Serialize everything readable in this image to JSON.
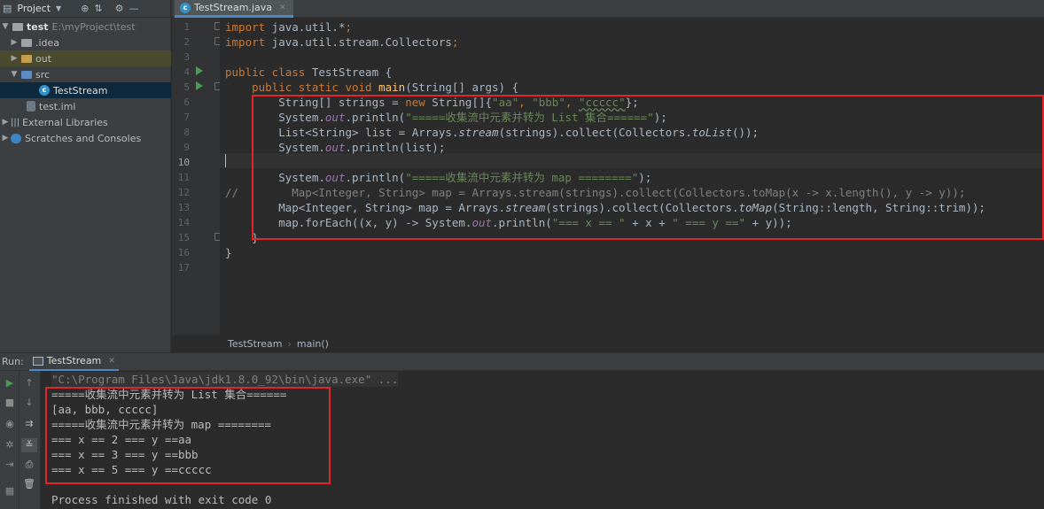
{
  "project_panel": {
    "header": {
      "title": "Project",
      "dropdown_icon": "chevron-down-icon",
      "icons": [
        "target-icon",
        "collapse-icon",
        "gear-icon",
        "minimize-icon"
      ]
    },
    "tree": [
      {
        "label": "test",
        "detail": "E:\\myProject\\test",
        "depth": 0,
        "expanded": true,
        "icon": "module-folder-icon"
      },
      {
        "label": ".idea",
        "depth": 1,
        "expanded": false,
        "icon": "folder-icon"
      },
      {
        "label": "out",
        "depth": 1,
        "expanded": false,
        "icon": "folder-icon"
      },
      {
        "label": "src",
        "depth": 1,
        "expanded": true,
        "icon": "source-folder-icon"
      },
      {
        "label": "TestStream",
        "depth": 2,
        "selected": true,
        "icon": "java-class-icon"
      },
      {
        "label": "test.iml",
        "depth": 1,
        "icon": "iml-file-icon"
      },
      {
        "label": "External Libraries",
        "depth": 0,
        "expanded": false,
        "icon": "libraries-icon"
      },
      {
        "label": "Scratches and Consoles",
        "depth": 0,
        "expanded": false,
        "icon": "scratches-icon"
      }
    ]
  },
  "editor": {
    "tab_label": "TestStream.java",
    "line_numbers": [
      "1",
      "2",
      "3",
      "4",
      "5",
      "6",
      "7",
      "8",
      "9",
      "10",
      "11",
      "12",
      "13",
      "14",
      "15",
      "16",
      "17"
    ],
    "current_line": "10",
    "code": {
      "l1_a": "import",
      "l1_b": " java.util.*",
      "l1_c": ";",
      "l2_a": "import",
      "l2_b": " java.util.stream.Collectors",
      "l2_c": ";",
      "l4_a": "public class",
      "l4_b": " TestStream {",
      "l5_a": "    public static void ",
      "l5_b": "main",
      "l5_c": "(String[] args) {",
      "l6_a": "        String[] strings = ",
      "l6_b": "new",
      "l6_c": " String[]{",
      "l6_d": "\"aa\"",
      "l6_e": ", ",
      "l6_f": "\"bbb\"",
      "l6_g": ", ",
      "l6_h": "\"ccccc\"",
      "l6_i": "};",
      "l7_a": "        System.",
      "l7_b": "out",
      "l7_c": ".println(",
      "l7_d": "\"=====收集流中元素并转为 List 集合======\"",
      "l7_e": ");",
      "l8_a": "        List<String> list = Arrays.",
      "l8_b": "stream",
      "l8_c": "(strings).collect(Collectors.",
      "l8_d": "toList",
      "l8_e": "());",
      "l9_a": "        System.",
      "l9_b": "out",
      "l9_c": ".println(list);",
      "l11_a": "        System.",
      "l11_b": "out",
      "l11_c": ".println(",
      "l11_d": "\"=====收集流中元素并转为 map ========\"",
      "l11_e": ");",
      "l12": "//        Map<Integer, String> map = Arrays.stream(strings).collect(Collectors.toMap(x -> x.length(), y -> y));",
      "l13_a": "        Map<Integer, String> map = Arrays.",
      "l13_b": "stream",
      "l13_c": "(strings).collect(Collectors.",
      "l13_d": "toMap",
      "l13_e": "(String::length, String::trim));",
      "l14_a": "        map.forEach((x, y) -> System.",
      "l14_b": "out",
      "l14_c": ".println(",
      "l14_d": "\"=== x == \"",
      "l14_e": " + x + ",
      "l14_f": "\" === y ==\"",
      "l14_g": " + y));",
      "l15": "    }",
      "l16": "}"
    },
    "breadcrumb": [
      "TestStream",
      "main()"
    ]
  },
  "run_panel": {
    "label": "Run:",
    "tab_label": "TestStream",
    "console_lines": [
      "\"C:\\Program Files\\Java\\jdk1.8.0_92\\bin\\java.exe\" ...",
      "=====收集流中元素并转为 List 集合======",
      "[aa, bbb, ccccc]",
      "=====收集流中元素并转为 map ========",
      "=== x == 2 === y ==aa",
      "=== x == 3 === y ==bbb",
      "=== x == 5 === y ==ccccc",
      "",
      "Process finished with exit code 0"
    ]
  },
  "colors": {
    "highlight_box": "#e0252b",
    "keyword": "#cc7832",
    "string": "#6a8759",
    "method_decl": "#ffc66d",
    "field": "#9876aa"
  }
}
